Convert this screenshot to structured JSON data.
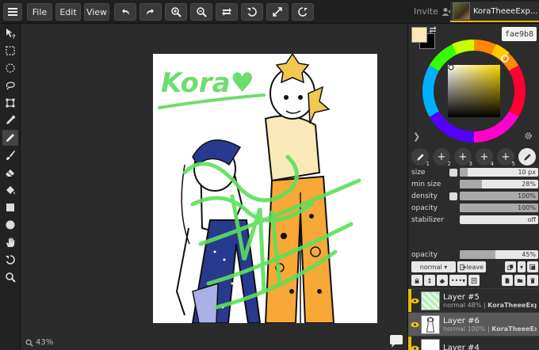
{
  "menu": {
    "file_label": "File",
    "edit_label": "Edit",
    "view_label": "View"
  },
  "topbar": {
    "invite_label": "Invite",
    "username": "KoraTheeeExp..."
  },
  "workspace": {
    "zoom": "43%"
  },
  "color": {
    "primary": "#fae9b8",
    "secondary": "#000000",
    "hex": "fae9b8"
  },
  "brushes": [
    {
      "slot": "1"
    },
    {
      "slot": "2"
    },
    {
      "slot": "3"
    },
    {
      "slot": "4"
    },
    {
      "slot": "5"
    },
    {
      "slot": "6"
    }
  ],
  "brush_props": {
    "size": {
      "label": "size",
      "value": "10 px",
      "fraction": 0.1
    },
    "min_size": {
      "label": "min size",
      "value": "28%",
      "fraction": 0.28
    },
    "density": {
      "label": "density",
      "value": "100%",
      "fraction": 1.0
    },
    "opacity": {
      "label": "opacity",
      "value": "100%",
      "fraction": 1.0
    },
    "stabilizer": {
      "label": "stabilizer",
      "value": "off",
      "fraction": 0.0
    }
  },
  "layer_opacity": {
    "label": "opacity",
    "value": "45%",
    "fraction": 0.45
  },
  "layer_controls": {
    "blend_mode": "normal",
    "leave_label": "leave"
  },
  "layers": [
    {
      "name": "Layer #5",
      "meta": "normal 48% |",
      "owner": "KoraTheeeExp...",
      "selected": false
    },
    {
      "name": "Layer #6",
      "meta": "normal 100% |",
      "owner": "KoraTheeeExp...",
      "selected": true
    },
    {
      "name": "Layer #4",
      "meta": "",
      "owner": "",
      "selected": false
    }
  ],
  "artwork": {
    "signature": "Kora♥"
  }
}
